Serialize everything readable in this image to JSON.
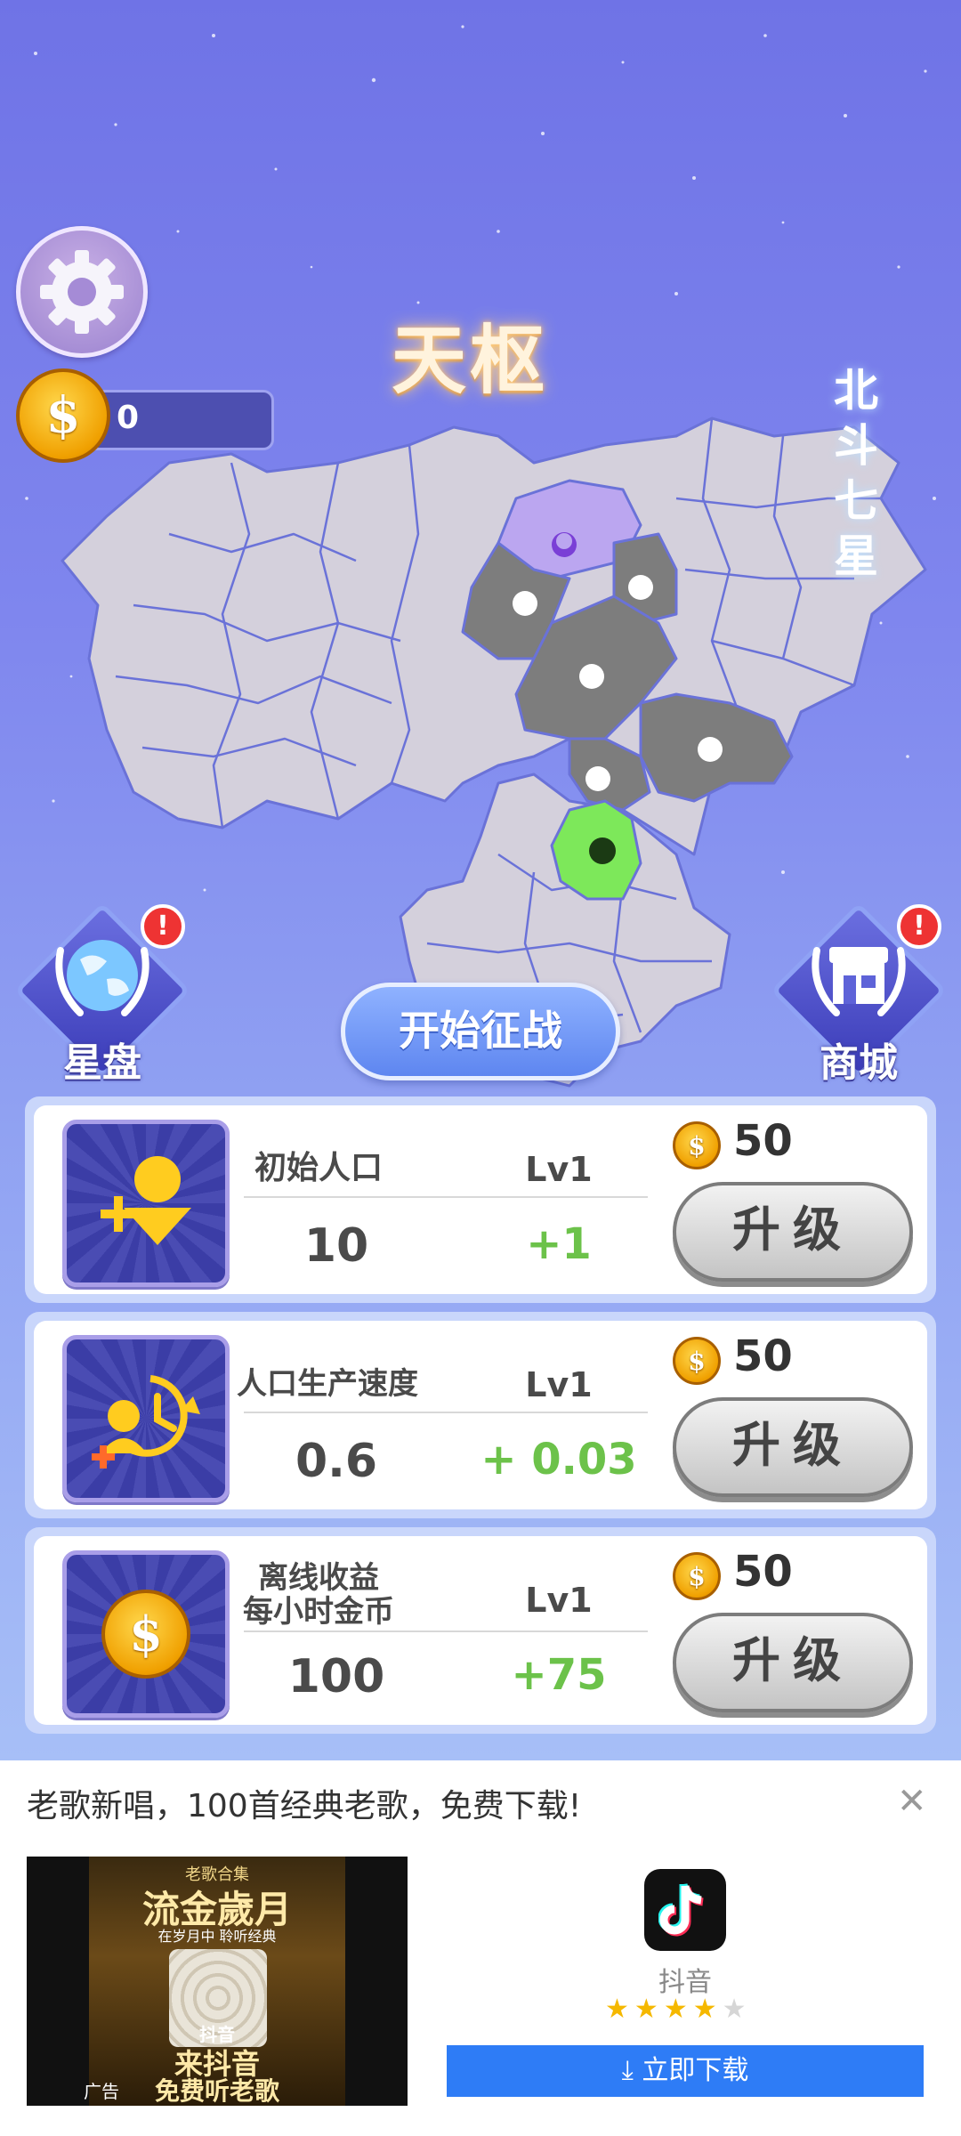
{
  "header": {
    "title": "天枢",
    "side_title": "北斗七星",
    "coins": "0"
  },
  "buttons": {
    "star_disk": "星盘",
    "shop": "商城",
    "start": "开始征战",
    "alert_mark": "!"
  },
  "upgrades": [
    {
      "name": "初始人口",
      "level": "Lv1",
      "value": "10",
      "increment": "+1",
      "cost": "50",
      "button": "升级",
      "icon": "add-person-icon"
    },
    {
      "name": "人口生产速度",
      "level": "Lv1",
      "value": "0.6",
      "increment": "+ 0.03",
      "cost": "50",
      "button": "升级",
      "icon": "population-speed-icon"
    },
    {
      "name_line1": "离线收益",
      "name_line2": "每小时金币",
      "level": "Lv1",
      "value": "100",
      "increment": "+75",
      "cost": "50",
      "button": "升级",
      "icon": "gold-coin-icon"
    }
  ],
  "ad": {
    "text": "老歌新唱，100首经典老歌，免费下载!",
    "image_title": "流金歲月",
    "image_top": "老歌合集",
    "image_sub": "在岁月中 聆听经典",
    "image_brand": "抖音",
    "image_bottom1": "来抖音",
    "image_bottom2": "免费听老歌",
    "ad_label": "广告",
    "app_name": "抖音",
    "rating": 4,
    "rating_max": 5,
    "download": "立即下载"
  },
  "colors": {
    "owned_region": "#7d7d7d",
    "player_region": "#7de85a",
    "capital_region": "#bba6f0",
    "neutral_region": "#d4d0dc",
    "increment_green": "#6cc24a",
    "download_blue": "#2e7cf6"
  }
}
